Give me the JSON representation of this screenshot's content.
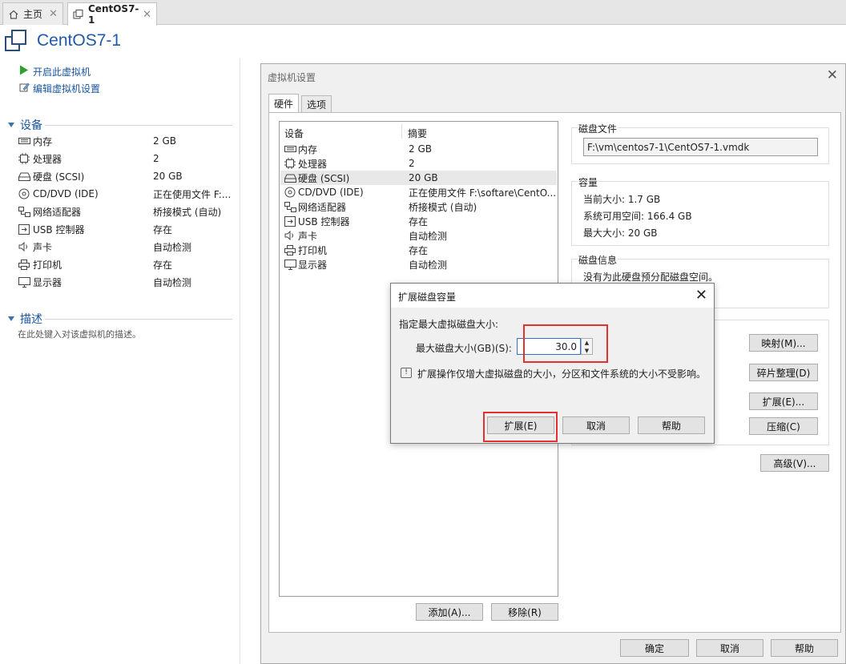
{
  "tabs": [
    {
      "label": "主页",
      "icon": "home-icon"
    },
    {
      "label": "CentOS7-1",
      "icon": "vm-icon"
    }
  ],
  "vm_title": "CentOS7-1",
  "actions": [
    {
      "label": "开启此虚拟机",
      "icon": "play-icon"
    },
    {
      "label": "编辑虚拟机设置",
      "icon": "edit-icon"
    }
  ],
  "devices_section": {
    "title": "设备"
  },
  "devices": [
    {
      "name": "内存",
      "value": "2 GB",
      "icon": "memory-icon"
    },
    {
      "name": "处理器",
      "value": "2",
      "icon": "cpu-icon"
    },
    {
      "name": "硬盘 (SCSI)",
      "value": "20 GB",
      "icon": "harddisk-icon"
    },
    {
      "name": "CD/DVD (IDE)",
      "value": "正在使用文件 F:...",
      "icon": "cd-icon"
    },
    {
      "name": "网络适配器",
      "value": "桥接模式 (自动)",
      "icon": "network-icon"
    },
    {
      "name": "USB 控制器",
      "value": "存在",
      "icon": "usb-icon"
    },
    {
      "name": "声卡",
      "value": "自动检测",
      "icon": "sound-icon"
    },
    {
      "name": "打印机",
      "value": "存在",
      "icon": "printer-icon"
    },
    {
      "name": "显示器",
      "value": "自动检测",
      "icon": "display-icon"
    }
  ],
  "description_section": {
    "title": "描述",
    "placeholder": "在此处键入对该虚拟机的描述。"
  },
  "settings_dialog": {
    "title": "虚拟机设置",
    "tabs": [
      "硬件",
      "选项"
    ],
    "list_headers": {
      "device": "设备",
      "summary": "摘要"
    },
    "list": [
      {
        "name": "内存",
        "value": "2 GB",
        "icon": "memory-icon"
      },
      {
        "name": "处理器",
        "value": "2",
        "icon": "cpu-icon"
      },
      {
        "name": "硬盘 (SCSI)",
        "value": "20 GB",
        "icon": "harddisk-icon",
        "selected": true
      },
      {
        "name": "CD/DVD (IDE)",
        "value": "正在使用文件 F:\\softare\\CentO...",
        "icon": "cd-icon"
      },
      {
        "name": "网络适配器",
        "value": "桥接模式 (自动)",
        "icon": "network-icon"
      },
      {
        "name": "USB 控制器",
        "value": "存在",
        "icon": "usb-icon"
      },
      {
        "name": "声卡",
        "value": "自动检测",
        "icon": "sound-icon"
      },
      {
        "name": "打印机",
        "value": "存在",
        "icon": "printer-icon"
      },
      {
        "name": "显示器",
        "value": "自动检测",
        "icon": "display-icon"
      }
    ],
    "add_button": "添加(A)...",
    "remove_button": "移除(R)",
    "disk_file": {
      "title": "磁盘文件",
      "path": "F:\\vm\\centos7-1\\CentOS7-1.vmdk"
    },
    "capacity": {
      "title": "容量",
      "current": "当前大小: 1.7 GB",
      "available": "系统可用空间: 166.4 GB",
      "max": "最大大小: 20 GB"
    },
    "disk_info": {
      "title": "磁盘信息",
      "text": "没有为此硬盘预分配磁盘空间。"
    },
    "utility_buttons": {
      "map": "映射(M)...",
      "defrag": "碎片整理(D)",
      "expand": "扩展(E)...",
      "compact": "压缩(C)"
    },
    "advanced_button": "高级(V)...",
    "ok_button": "确定",
    "cancel_button": "取消",
    "help_button": "帮助"
  },
  "expand_dialog": {
    "title": "扩展磁盘容量",
    "prompt": "指定最大虚拟磁盘大小:",
    "size_label": "最大磁盘大小(GB)(S):",
    "size_value": "30.0",
    "info": "扩展操作仅增大虚拟磁盘的大小，分区和文件系统的大小不受影响。",
    "expand_button": "扩展(E)",
    "cancel_button": "取消",
    "help_button": "帮助"
  },
  "highlight_color": "#e53030",
  "accent_color": "#1a55a0"
}
